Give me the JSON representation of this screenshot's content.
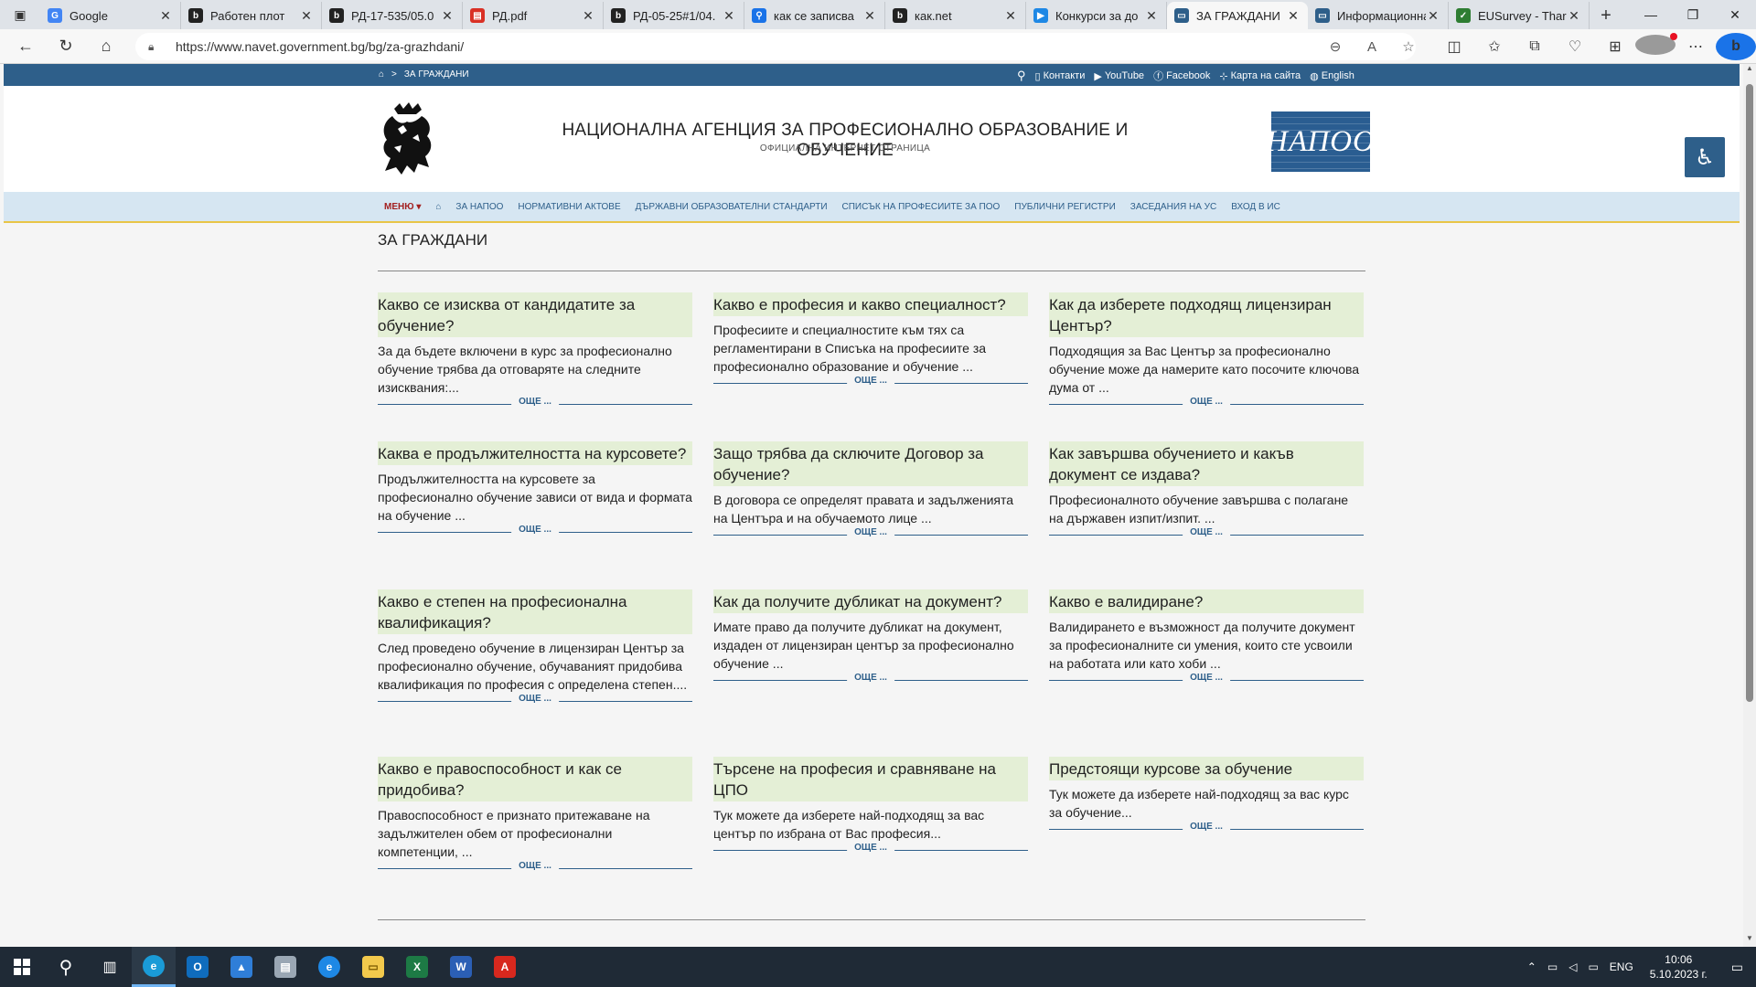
{
  "browser": {
    "tabs": [
      {
        "title": "Google",
        "favicon": "google-icon",
        "color": "#4285f4",
        "glyph": "G"
      },
      {
        "title": "Работен плот",
        "favicon": "b-icon",
        "color": "#222222",
        "glyph": "b"
      },
      {
        "title": "РД-17-535/05.0",
        "favicon": "b-icon",
        "color": "#222222",
        "glyph": "b"
      },
      {
        "title": "РД.pdf",
        "favicon": "pdf-icon",
        "color": "#d93025",
        "glyph": "▤"
      },
      {
        "title": "РД-05-25#1/04.",
        "favicon": "b-icon",
        "color": "#222222",
        "glyph": "b"
      },
      {
        "title": "как се записва",
        "favicon": "search-icon",
        "color": "#1a73e8",
        "glyph": "⚲"
      },
      {
        "title": "как.net",
        "favicon": "b-icon",
        "color": "#222222",
        "glyph": "b"
      },
      {
        "title": "Конкурси за до",
        "favicon": "flag-icon",
        "color": "#1e88e5",
        "glyph": "▶"
      },
      {
        "title": "ЗА ГРАЖДАНИ",
        "favicon": "page-icon",
        "color": "#2e5f8a",
        "glyph": "▭",
        "active": true
      },
      {
        "title": "Информационна",
        "favicon": "page-icon",
        "color": "#2e5f8a",
        "glyph": "▭"
      },
      {
        "title": "EUSurvey - Thar",
        "favicon": "check-icon",
        "color": "#2e7d32",
        "glyph": "✓"
      }
    ],
    "url": "https://www.navet.government.bg/bg/za-grazhdani/"
  },
  "topstrip": {
    "breadcrumb_sep": ">",
    "breadcrumb_current": "ЗА ГРАЖДАНИ",
    "contacts": "Контакти",
    "youtube": "YouTube",
    "facebook": "Facebook",
    "sitemap": "Карта на сайта",
    "english": "English"
  },
  "header": {
    "title": "НАЦИОНАЛНА АГЕНЦИЯ ЗА ПРОФЕСИОНАЛНО ОБРАЗОВАНИЕ И ОБУЧЕНИЕ",
    "subtitle": "ОФИЦИАЛНА ИНТЕРНЕТ СТРАНИЦА",
    "logo_text": "НАПОО"
  },
  "nav": {
    "menu": "МЕНЮ",
    "items": [
      "ЗА НАПОО",
      "НОРМАТИВНИ АКТОВЕ",
      "ДЪРЖАВНИ ОБРАЗОВАТЕЛНИ СТАНДАРТИ",
      "СПИСЪК НА ПРОФЕСИИТЕ ЗА ПОО",
      "ПУБЛИЧНИ РЕГИСТРИ",
      "ЗАСЕДАНИЯ НА УС",
      "ВХОД В ИС"
    ]
  },
  "page": {
    "title": "ЗА ГРАЖДАНИ",
    "more_label": "ОЩЕ ...",
    "cards": [
      {
        "title": "Какво се изисква от кандидатите за обучение?",
        "text": "За да бъдете включени в курс за професионално обучение трябва да отговаряте на следните изисквания:..."
      },
      {
        "title": "Какво е професия и какво специалност?",
        "text": "Професиите и специалностите към тях са регламентирани в Списъка на професиите за професионално образование и обучение ..."
      },
      {
        "title": "Как да изберете подходящ лицензиран Център?",
        "text": "Подходящия за Вас Център за професионално обучение може да намерите като посочите ключова дума от ..."
      },
      {
        "title": "Каква е продължителността на курсовете?",
        "text": "Продължителността на курсовете за професионално обучение зависи от вида и формата на обучение ..."
      },
      {
        "title": "Защо трябва да сключите Договор за обучение?",
        "text": "В договора се определят правата и задълженията на Центъра и на обучаемото лице ..."
      },
      {
        "title": "Как завършва обучението и какъв документ се издава?",
        "text": "Професионалното обучение завършва с полагане на държавен изпит/изпит. ..."
      },
      {
        "title": "Какво е степен на професионална квалификация?",
        "text": "След проведено обучение в лицензиран Център за професионално обучение, обучаваният придобива квалификация по професия с определена степен...."
      },
      {
        "title": "Как да получите дубликат на документ?",
        "text": "Имате право да получите дубликат на документ, издаден от лицензиран център за професионално обучение ..."
      },
      {
        "title": "Какво е валидиране?",
        "text": "Валидирането е възможност да получите документ за професионалните си умения, които сте усвоили на работата или като хоби ..."
      },
      {
        "title": "Какво е правоспособност и как се придобива?",
        "text": "Правоспособност е признато притежаване на задължителен обем от професионални компетенции, ..."
      },
      {
        "title": "Търсене на професия и сравняване на ЦПО",
        "text": "Тук можете да изберете най-подходящ за вас център по избрана от Вас професия..."
      },
      {
        "title": "Предстоящи курсове за обучение",
        "text": "Тук можете да изберете най-подходящ за вас курс за обучение..."
      }
    ]
  },
  "taskbar": {
    "language": "ENG",
    "time": "10:06",
    "date": "5.10.2023 г."
  }
}
